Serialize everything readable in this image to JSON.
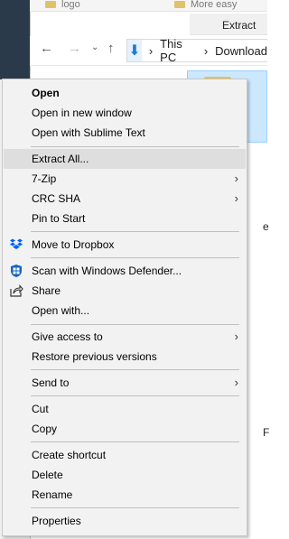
{
  "explorer": {
    "top_files": [
      "logo",
      "More easy"
    ],
    "ribbon_tab": "Extract To",
    "address": {
      "this_pc": "This PC",
      "separator": "›",
      "downloads": "Download"
    }
  },
  "context_menu": {
    "items": [
      {
        "label": "Open"
      },
      {
        "label": "Open in new window"
      },
      {
        "label": "Open with Sublime Text"
      },
      {
        "label": "Extract All..."
      },
      {
        "label": "7-Zip"
      },
      {
        "label": "CRC SHA"
      },
      {
        "label": "Pin to Start"
      },
      {
        "label": "Move to Dropbox"
      },
      {
        "label": "Scan with Windows Defender..."
      },
      {
        "label": "Share"
      },
      {
        "label": "Open with..."
      },
      {
        "label": "Give access to"
      },
      {
        "label": "Restore previous versions"
      },
      {
        "label": "Send to"
      },
      {
        "label": "Cut"
      },
      {
        "label": "Copy"
      },
      {
        "label": "Create shortcut"
      },
      {
        "label": "Delete"
      },
      {
        "label": "Rename"
      },
      {
        "label": "Properties"
      }
    ],
    "highlighted": "Extract All...",
    "submenu_arrow": "›"
  },
  "colors": {
    "menu_bg": "#f2f2f2",
    "hover_bg": "#dedede",
    "dropbox_blue": "#0061ff",
    "defender_blue": "#1565c0",
    "selection_bg": "#cce8ff"
  }
}
